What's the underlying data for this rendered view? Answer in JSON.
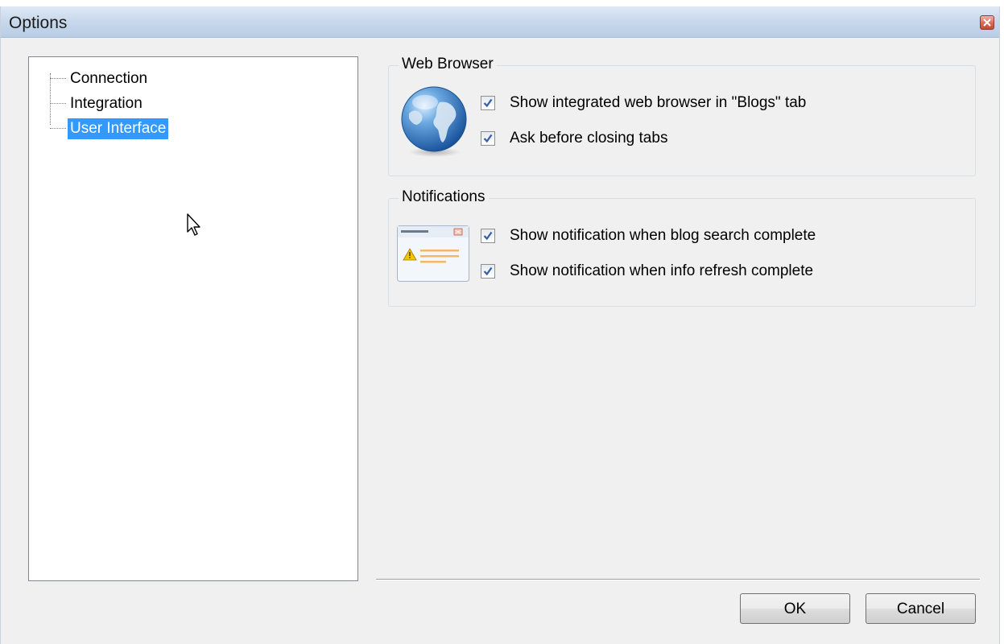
{
  "window": {
    "title": "Options"
  },
  "tree": {
    "items": [
      {
        "label": "Connection",
        "selected": false
      },
      {
        "label": "Integration",
        "selected": false
      },
      {
        "label": "User Interface",
        "selected": true
      }
    ]
  },
  "web_browser": {
    "title": "Web Browser",
    "icon": "globe-icon",
    "options": [
      {
        "label": "Show integrated web browser in \"Blogs\" tab",
        "checked": true
      },
      {
        "label": "Ask before closing tabs",
        "checked": true
      }
    ]
  },
  "notifications": {
    "title": "Notifications",
    "icon": "notification-window-icon",
    "options": [
      {
        "label": "Show notification when blog search complete",
        "checked": true
      },
      {
        "label": "Show notification when info refresh complete",
        "checked": true
      }
    ]
  },
  "buttons": {
    "ok": "OK",
    "cancel": "Cancel"
  },
  "colors": {
    "selection": "#3399ff",
    "dialog_bg": "#f0f0f0",
    "titlebar": "#c9d9ec"
  }
}
